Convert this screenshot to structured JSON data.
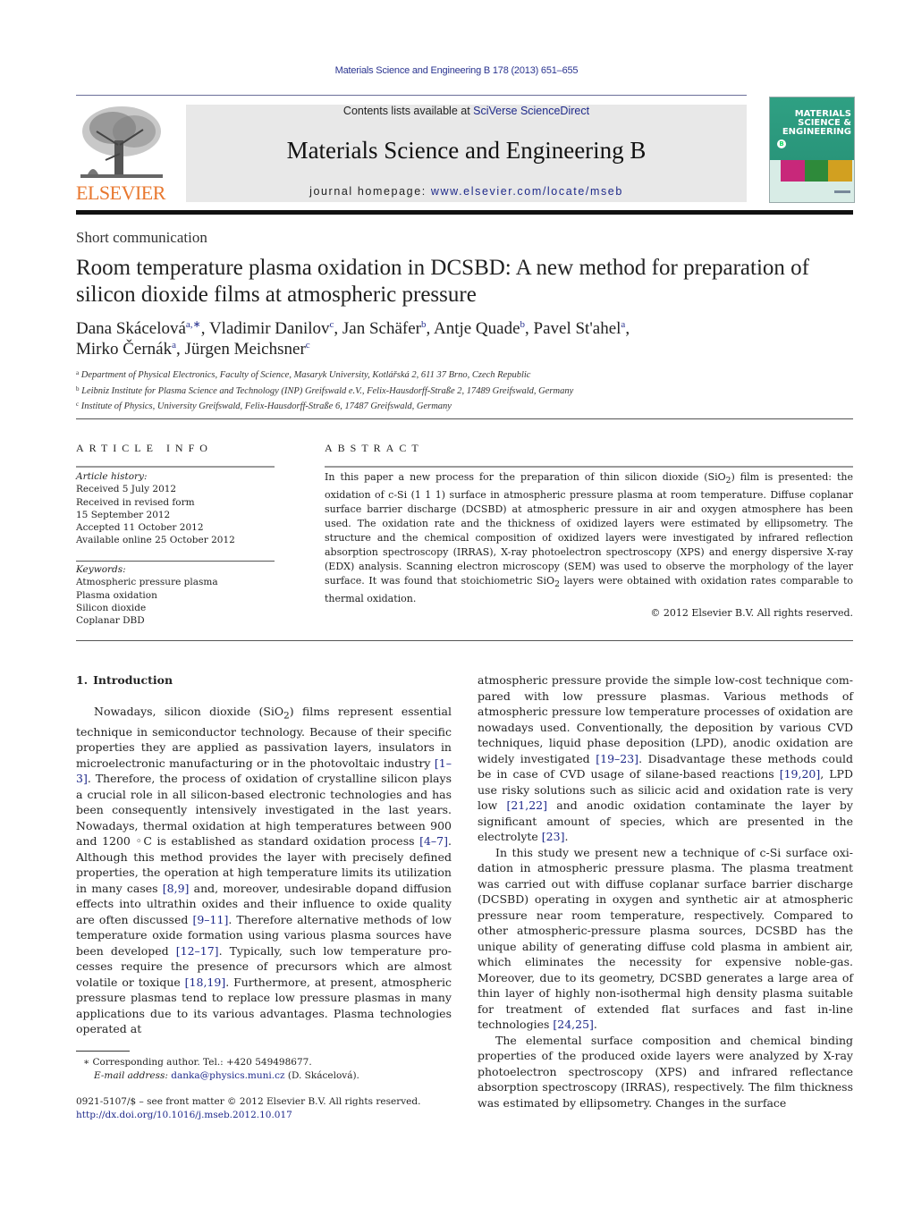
{
  "header": {
    "journal_ref": "Materials Science and Engineering B 178 (2013) 651–655",
    "contents_prefix": "Contents lists available at ",
    "contents_link": "SciVerse ScienceDirect",
    "journal_title": "Materials Science and Engineering B",
    "homepage_prefix": "journal homepage: ",
    "homepage_link": "www.elsevier.com/locate/mseb",
    "publisher_logo_text": "ELSEVIER",
    "cover": {
      "title_line1": "MATERIALS",
      "title_line2": "SCIENCE &",
      "title_line3": "ENGINEERING",
      "series_letter": "B",
      "image_colors": [
        "#c8287a",
        "#2e8a3a",
        "#d2a020"
      ]
    }
  },
  "article": {
    "type": "Short communication",
    "title": "Room temperature plasma oxidation in DCSBD: A new method for preparation of silicon dioxide films at atmospheric pressure",
    "authors": [
      {
        "name": "Dana Skácelová",
        "sup": "a,∗",
        "sep": ", "
      },
      {
        "name": "Vladimir Danilov",
        "sup": "c",
        "sep": ", "
      },
      {
        "name": "Jan Schäfer",
        "sup": "b",
        "sep": ", "
      },
      {
        "name": "Antje Quade",
        "sup": "b",
        "sep": ", "
      },
      {
        "name": "Pavel St'ahel",
        "sup": "a",
        "sep": ","
      },
      {
        "name": "Mirko Černák",
        "sup": "a",
        "sep": ", "
      },
      {
        "name": "Jürgen Meichsner",
        "sup": "c",
        "sep": ""
      }
    ],
    "affiliations": [
      {
        "key": "a",
        "text": "Department of Physical Electronics, Faculty of Science, Masaryk University, Kotlářská 2, 611 37 Brno, Czech Republic"
      },
      {
        "key": "b",
        "text": "Leibniz Institute for Plasma Science and Technology (INP) Greifswald e.V., Felix-Hausdorff-Straße 2, 17489 Greifswald, Germany"
      },
      {
        "key": "c",
        "text": "Institute of Physics, University Greifswald, Felix-Hausdorff-Straße 6, 17487 Greifswald, Germany"
      }
    ]
  },
  "article_info": {
    "label": "ARTICLE INFO",
    "history_label": "Article history:",
    "history": [
      "Received 5 July 2012",
      "Received in revised form",
      "15 September 2012",
      "Accepted 11 October 2012",
      "Available online 25 October 2012"
    ],
    "keywords_label": "Keywords:",
    "keywords": [
      "Atmospheric pressure plasma",
      "Plasma oxidation",
      "Silicon dioxide",
      "Coplanar DBD"
    ]
  },
  "abstract": {
    "label": "ABSTRACT",
    "p1": "In this paper a new process for the preparation of thin silicon dioxide (SiO",
    "p1_sub": "2",
    "p2": ") film is presented: the oxidation of c-Si (1 1 1) surface in atmospheric pressure plasma at room temperature. Diffuse coplanar surface barrier discharge (DCSBD) at atmospheric pressure in air and oxygen atmosphere has been used. The oxidation rate and the thickness of oxidized layers were estimated by ellipsometry. The structure and the chemical composition of oxidized layers were investigated by infrared reflection absorption spectroscopy (IRRAS), X-ray photoelectron spectroscopy (XPS) and energy dispersive X-ray (EDX) analysis. Scanning electron microscopy (SEM) was used to observe the morphology of the layer surface. It was found that stoichiometric SiO",
    "p2_sub": "2",
    "p3": " layers were obtained with oxidation rates comparable to thermal oxidation.",
    "copyright": "© 2012 Elsevier B.V. All rights reserved."
  },
  "body": {
    "section_number": "1.",
    "section_title": "Introduction",
    "left_paragraph": [
      {
        "t": "Nowadays, silicon dioxide (SiO"
      },
      {
        "sub": "2"
      },
      {
        "t": ") films represent essential tech­nique in semiconductor technology. Because of their specific properties they are applied as passivation layers, insulators in microelectronic manufacturing or in the photovoltaic industry "
      },
      {
        "ref": "[1–3]"
      },
      {
        "t": ". Therefore, the process of oxidation of crystalline silicon plays a crucial role in all silicon-based electronic technologies and has been consequently intensively investigated in the last years. Nowadays, thermal oxidation at high temperatures between 900 and 1200 ◦C is established as standard oxidation process "
      },
      {
        "ref": "[4–7]"
      },
      {
        "t": ". Although this method provides the layer with precisely defined properties, the operation at high temperature limits its utilization in many cases "
      },
      {
        "ref": "[8,9]"
      },
      {
        "t": " and, moreover, undesirable dopand diffusion effects into ultrathin oxides and their influence to oxide qual­ity are often discussed "
      },
      {
        "ref": "[9–11]"
      },
      {
        "t": ". Therefore alternative methods of low temperature oxide formation using various plasma sources have been developed "
      },
      {
        "ref": "[12–17]"
      },
      {
        "t": ". Typically, such low temperature pro­cesses require the presence of precursors which are almost volatile or toxique "
      },
      {
        "ref": "[18,19]"
      },
      {
        "t": ". Furthermore, at present, atmospheric pressure plasmas tend to replace low pressure plasmas in many applica­tions due to its various advantages. Plasma technologies operated at"
      }
    ],
    "right_paragraphs": [
      {
        "indent": false,
        "parts": [
          {
            "t": "atmospheric pressure provide the simple low-cost technique com­pared with low pressure plasmas. Various methods of atmospheric pressure low temperature processes of oxidation are nowadays used. Conventionally, the deposition by various CVD techniques, liquid phase deposition (LPD), anodic oxidation are widely inves­tigated "
          },
          {
            "ref": "[19–23]"
          },
          {
            "t": ". Disadvantage these methods could be in case of CVD usage of silane-based reactions "
          },
          {
            "ref": "[19,20]"
          },
          {
            "t": ", LPD use risky solu­tions such as silicic acid and oxidation rate is very low "
          },
          {
            "ref": "[21,22]"
          },
          {
            "t": " and anodic oxidation contaminate the layer by significant amount of species, which are presented in the electrolyte "
          },
          {
            "ref": "[23]"
          },
          {
            "t": "."
          }
        ]
      },
      {
        "indent": true,
        "parts": [
          {
            "t": "In this study we present new a technique of c-Si surface oxi­dation in atmospheric pressure plasma. The plasma treatment was carried out with diffuse coplanar surface barrier discharge (DCSBD) operating in oxygen and synthetic air at atmospheric pressure near room temperature, respectively. Compared to other atmospheric-pressure plasma sources, DCSBD has the unique ability of generating diffuse cold plasma in ambient air, which elim­inates the necessity for expensive noble-gas. Moreover, due to its geometry, DCSBD generates a large area of thin layer of highly non-isothermal high density plasma suitable for treatment of extended flat surfaces and fast in-line technologies "
          },
          {
            "ref": "[24,25]"
          },
          {
            "t": "."
          }
        ]
      },
      {
        "indent": true,
        "parts": [
          {
            "t": "The elemental surface composition and chemical binding properties of the produced oxide layers were analyzed by X-ray photoelectron spectroscopy (XPS) and infrared reflectance absorption spectroscopy (IRRAS), respectively. The film thick­ness was estimated by ellipsometry. Changes in the surface"
          }
        ]
      }
    ]
  },
  "footnotes": {
    "corresponding_mark": "∗",
    "corresponding_text": "Corresponding author. Tel.: +420 549498677.",
    "email_label": "E-mail address: ",
    "email": "danka@physics.muni.cz",
    "email_suffix": " (D. Skácelová).",
    "issn_line": "0921-5107/$ – see front matter © 2012 Elsevier B.V. All rights reserved.",
    "doi": "http://dx.doi.org/10.1016/j.mseb.2012.10.017"
  }
}
